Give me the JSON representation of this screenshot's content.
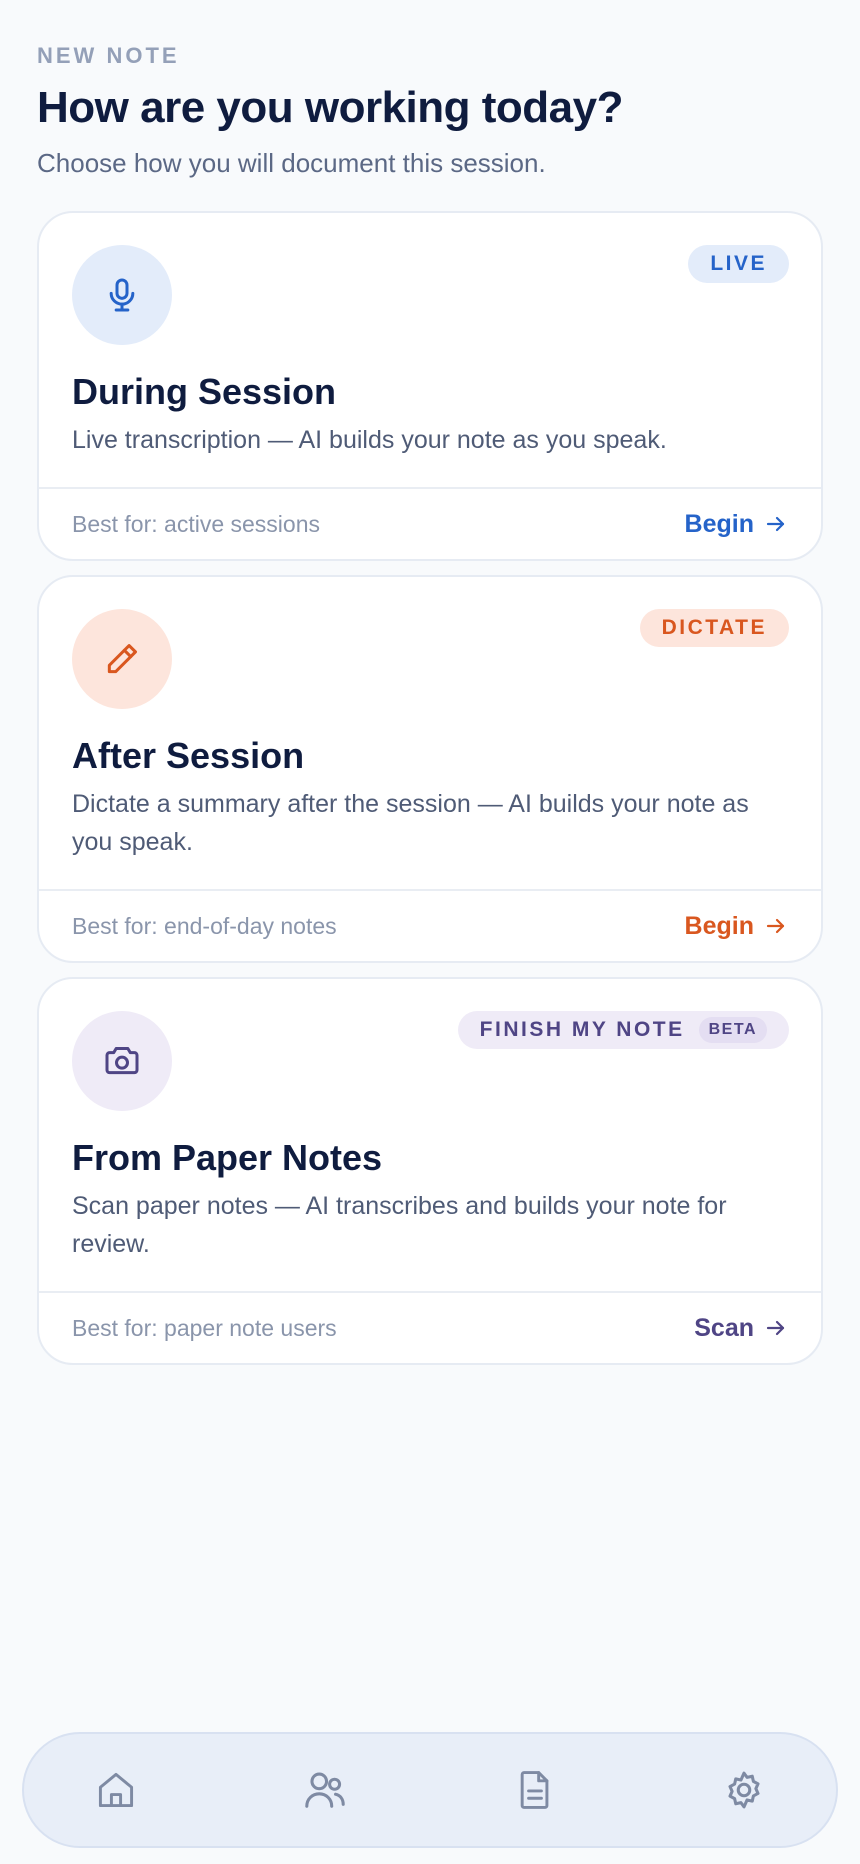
{
  "header": {
    "eyebrow": "NEW NOTE",
    "title": "How are you working today?",
    "subtitle": "Choose how you will document this session."
  },
  "cards": [
    {
      "icon": "microphone-icon",
      "badge": "LIVE",
      "title": "During Session",
      "description": "Live transcription — AI builds your note as you speak.",
      "best_for": "Best for: active sessions",
      "action": "Begin",
      "accent": "#2563c9",
      "tint": "#e3ecfa"
    },
    {
      "icon": "pencil-icon",
      "badge": "DICTATE",
      "title": "After Session",
      "description": "Dictate a summary after the session — AI builds your note as you speak.",
      "best_for": "Best for: end-of-day notes",
      "action": "Begin",
      "accent": "#d9571f",
      "tint": "#fde5dc"
    },
    {
      "icon": "camera-icon",
      "badge": "FINISH MY NOTE",
      "badge_extra": "BETA",
      "title": "From Paper Notes",
      "description": "Scan paper notes — AI transcribes and builds your note for review.",
      "best_for": "Best for: paper note users",
      "action": "Scan",
      "accent": "#4f4585",
      "tint": "#efebf7"
    }
  ],
  "nav": {
    "items": [
      "home-icon",
      "users-icon",
      "document-icon",
      "settings-icon"
    ],
    "color": "#7e8aa3"
  }
}
